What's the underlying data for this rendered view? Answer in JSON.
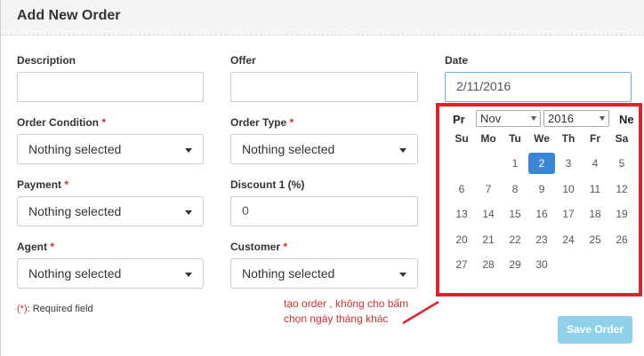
{
  "modal": {
    "title": "Add New Order"
  },
  "fields": {
    "description": {
      "label": "Description",
      "value": ""
    },
    "offer": {
      "label": "Offer",
      "value": ""
    },
    "date": {
      "label": "Date",
      "value": "2/11/2016"
    },
    "order_condition": {
      "label": "Order Condition",
      "required": "*",
      "value": "Nothing selected"
    },
    "order_type": {
      "label": "Order Type",
      "required": "*",
      "value": "Nothing selected"
    },
    "payment": {
      "label": "Payment",
      "required": "*",
      "value": "Nothing selected"
    },
    "discount": {
      "label": "Discount 1 (%)",
      "value": "0"
    },
    "agent": {
      "label": "Agent",
      "required": "*",
      "value": "Nothing selected"
    },
    "customer": {
      "label": "Customer",
      "required": "*",
      "value": "Nothing selected"
    }
  },
  "footnote": {
    "marker": "(*)",
    "text": ": Required field"
  },
  "save_button": {
    "label": "Save Order",
    "color": "#8fd1ea"
  },
  "datepicker": {
    "prev_label": "Pr",
    "next_label": "Ne",
    "month": "Nov",
    "year": "2016",
    "weekdays": [
      "Su",
      "Mo",
      "Tu",
      "We",
      "Th",
      "Fr",
      "Sa"
    ],
    "weeks": [
      [
        "",
        "",
        "1",
        "2",
        "3",
        "4",
        "5"
      ],
      [
        "6",
        "7",
        "8",
        "9",
        "10",
        "11",
        "12"
      ],
      [
        "13",
        "14",
        "15",
        "16",
        "17",
        "18",
        "19"
      ],
      [
        "20",
        "21",
        "22",
        "23",
        "24",
        "25",
        "26"
      ],
      [
        "27",
        "28",
        "29",
        "30",
        "",
        "",
        ""
      ]
    ],
    "selected_day": "2",
    "accent": "#3a87d4"
  },
  "annotation": {
    "text": "tạo order , không cho bấm chọn ngày tháng khác",
    "color": "#d9262c"
  }
}
